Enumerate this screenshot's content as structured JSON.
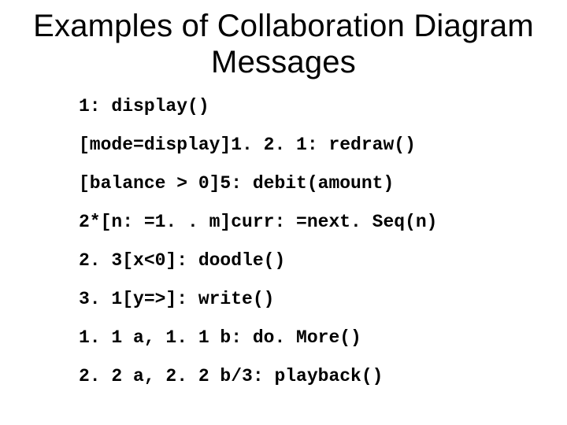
{
  "title": "Examples of Collaboration Diagram Messages",
  "examples": [
    "1: display()",
    "[mode=display]1. 2. 1: redraw()",
    "[balance > 0]5: debit(amount)",
    "2*[n: =1. . m]curr: =next. Seq(n)",
    "2. 3[x<0]: doodle()",
    "3. 1[y=>]: write()",
    "1. 1 a, 1. 1 b: do. More()",
    "2. 2 a, 2. 2 b/3: playback()"
  ]
}
